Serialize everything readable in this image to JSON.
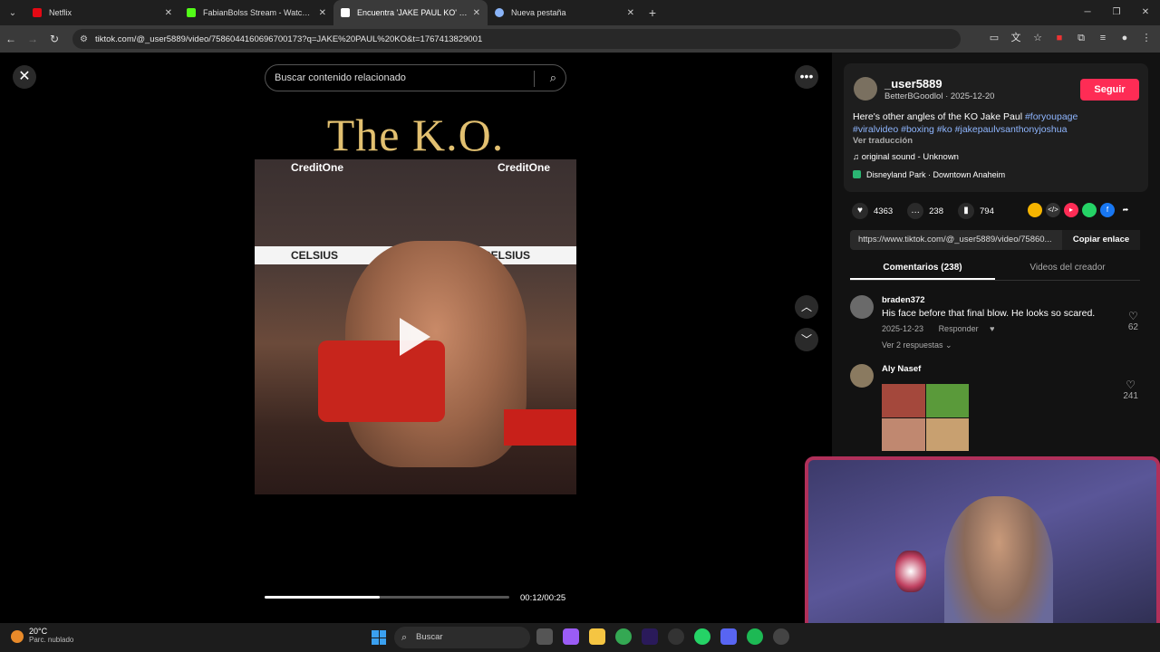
{
  "browser": {
    "tabs": [
      {
        "label": "Netflix",
        "color": "#e50914"
      },
      {
        "label": "FabianBolss Stream - Watch Live",
        "color": "#53fc18"
      },
      {
        "label": "Encuentra 'JAKE PAUL KO' en TikTok",
        "color": "#ffffff"
      },
      {
        "label": "Nueva pestaña",
        "color": "#8ab4f8"
      }
    ],
    "url": "tiktok.com/@_user5889/video/7586044160696700173?q=JAKE%20PAUL%20KO&t=1767413829001"
  },
  "video": {
    "search_placeholder": "Buscar contenido relacionado",
    "overlay_title": "The K.O.",
    "sponsor_1": "CreditOne",
    "sponsor_2": "CELSIUS",
    "time_display": "00:12/00:25",
    "progress_fraction": 0.47
  },
  "post": {
    "username": "_user5889",
    "subline": "BetterBGoodlol · 2025-12-20",
    "follow_label": "Seguir",
    "description_text": "Here's other angles of the KO Jake Paul ",
    "hashtags_line1": "#foryoupage",
    "hashtags_line2": "#viralvideo #boxing #ko #jakepaulvsanthonyjoshua",
    "translate_label": "Ver traducción",
    "sound": "original sound - Unknown",
    "location": "Disneyland Park · Downtown Anaheim",
    "likes": "4363",
    "comments": "238",
    "saves": "794",
    "link": "https://www.tiktok.com/@_user5889/video/75860...",
    "copy_label": "Copiar enlace"
  },
  "panel_tabs": {
    "comments": "Comentarios (238)",
    "creator_videos": "Videos del creador"
  },
  "comments": [
    {
      "name": "braden372",
      "text": "His face before that final blow. He looks so scared.",
      "date": "2025-12-23",
      "reply_label": "Responder",
      "replies": "Ver 2 respuestas",
      "likes": "62"
    },
    {
      "name": "Aly Nasef",
      "likes": "241"
    }
  ],
  "taskbar": {
    "temperature": "20°C",
    "weather": "Parc. nublado",
    "search_label": "Buscar"
  },
  "colors": {
    "follow": "#fe2c55",
    "hashtag": "#8fb6ff",
    "title_gold": "#e2c070",
    "webcam_border": "#b0305a"
  }
}
